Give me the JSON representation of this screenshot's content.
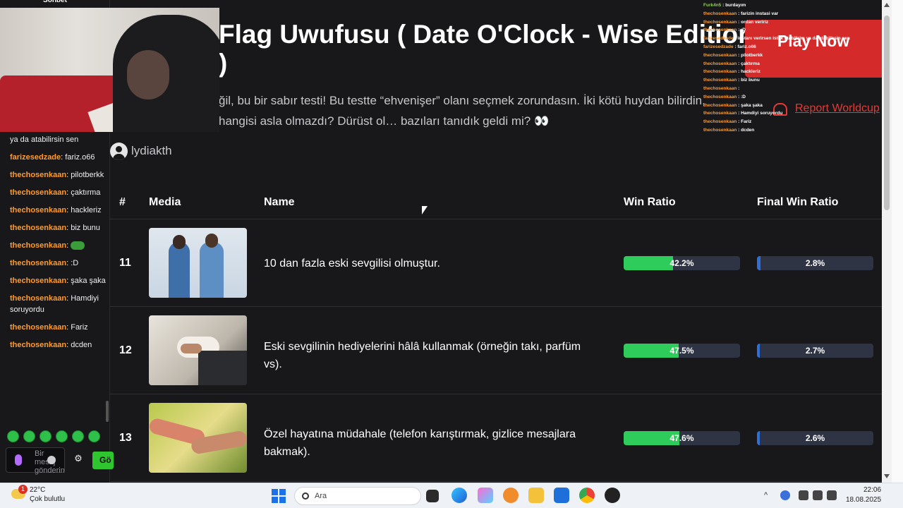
{
  "chat": {
    "tab_label": "Sohbet",
    "messages": [
      {
        "user": "",
        "text": "ya da atabilirsin sen"
      },
      {
        "user": "farizesedzade",
        "text": "fariz.o66"
      },
      {
        "user": "thechosenkaan",
        "text": "pilotberkk"
      },
      {
        "user": "thechosenkaan",
        "text": "çaktırma"
      },
      {
        "user": "thechosenkaan",
        "text": "hackleriz"
      },
      {
        "user": "thechosenkaan",
        "text": "biz bunu"
      },
      {
        "user": "thechosenkaan",
        "text": ""
      },
      {
        "user": "thechosenkaan",
        "text": ":D"
      },
      {
        "user": "thechosenkaan",
        "text": "şaka şaka"
      },
      {
        "user": "thechosenkaan",
        "text": "Hamdiyi soruyordu"
      },
      {
        "user": "thechosenkaan",
        "text": "Fariz"
      },
      {
        "user": "thechosenkaan",
        "text": "dcden"
      }
    ],
    "input_placeholder": "Bir mesaj gönderin",
    "send_label": "Gö"
  },
  "page": {
    "title": "Flag Uwufusu ( Date O'Clock - Wise Edition )",
    "description": "ğil, bu bir sabır testi! Bu testte “ehvenişer” olanı seçmek zorundasın. İki kötü huydan bilirdin, hangisi asla olmazdı? Dürüst ol… bazıları tanıdık geldi mi? 👀",
    "play_now": "Play Now",
    "report": "Report Worldcup",
    "author": "lydiakth"
  },
  "table": {
    "headers": {
      "rank": "#",
      "media": "Media",
      "name": "Name",
      "win_ratio": "Win Ratio",
      "final_win_ratio": "Final Win Ratio"
    },
    "rows": [
      {
        "rank": "11",
        "name": "10 dan fazla eski sevgilisi olmuştur.",
        "win_ratio": "42.2%",
        "win_value": 42.2,
        "final_win_ratio": "2.8%",
        "final_value": 2.8
      },
      {
        "rank": "12",
        "name": "Eski sevgilinin hediyelerini hâlâ kullanmak (örneğin takı, parfüm vs).",
        "win_ratio": "47.5%",
        "win_value": 47.5,
        "final_win_ratio": "2.7%",
        "final_value": 2.7
      },
      {
        "rank": "13",
        "name": "Özel hayatına müdahale (telefon karıştırmak, gizlice mesajlara bakmak).",
        "win_ratio": "47.6%",
        "win_value": 47.6,
        "final_win_ratio": "2.6%",
        "final_value": 2.6
      }
    ]
  },
  "overlay_chat": [
    {
      "user": "Furk4n5",
      "text": "burdayım",
      "green": true
    },
    {
      "user": "thechosenkaan",
      "text": "farizin instasi var"
    },
    {
      "user": "thechosenkaan",
      "text": "ordan veririz"
    },
    {
      "user": "thechosenkaan",
      "text": ":D"
    },
    {
      "user": "farizesedzade",
      "text": "instanı verirsen istek atabilirim ya da atabilirsin sen"
    },
    {
      "user": "farizesedzade",
      "text": "fariz.o66"
    },
    {
      "user": "thechosenkaan",
      "text": "pilotberkk"
    },
    {
      "user": "thechosenkaan",
      "text": "çaktırma"
    },
    {
      "user": "thechosenkaan",
      "text": "hackleriz"
    },
    {
      "user": "thechosenkaan",
      "text": "biz bunu"
    },
    {
      "user": "thechosenkaan",
      "text": ""
    },
    {
      "user": "thechosenkaan",
      "text": ":D"
    },
    {
      "user": "thechosenkaan",
      "text": "şaka şaka"
    },
    {
      "user": "thechosenkaan",
      "text": "Hamdiyi soruyordu"
    },
    {
      "user": "thechosenkaan",
      "text": "Fariz"
    },
    {
      "user": "thechosenkaan",
      "text": "dcden"
    }
  ],
  "taskbar": {
    "weather_temp": "22°C",
    "weather_desc": "Çok bulutlu",
    "weather_badge": "1",
    "search_label": "Ara",
    "time": "22:06",
    "date": "18.08.2025"
  },
  "colors": {
    "accent_red": "#d42a2a",
    "win_green": "#2ecc5a",
    "final_blue": "#2f6fd8",
    "chat_user": "#ff9b2f"
  }
}
